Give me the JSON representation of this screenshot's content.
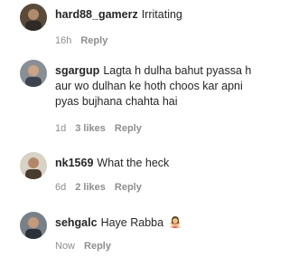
{
  "comments": [
    {
      "username": "hard88_gamerz",
      "text": "Irritating",
      "time": "16h",
      "likes": "",
      "reply_label": "Reply",
      "avatar_icon": "profile-photo"
    },
    {
      "username": "sgargup",
      "text": "Lagta h dulha bahut pyassa h aur wo dulhan ke hoth choos kar apni pyas bujhana chahta hai",
      "time": "1d",
      "likes": "3 likes",
      "reply_label": "Reply",
      "avatar_icon": "profile-photo"
    },
    {
      "username": "nk1569",
      "text": "What the heck",
      "time": "6d",
      "likes": "2 likes",
      "reply_label": "Reply",
      "avatar_icon": "profile-photo"
    },
    {
      "username": "sehgalc",
      "text": "Haye Rabba",
      "emoji": "woman-gesturing-no-emoji",
      "time": "Now",
      "likes": "",
      "reply_label": "Reply",
      "avatar_icon": "profile-photo"
    }
  ]
}
